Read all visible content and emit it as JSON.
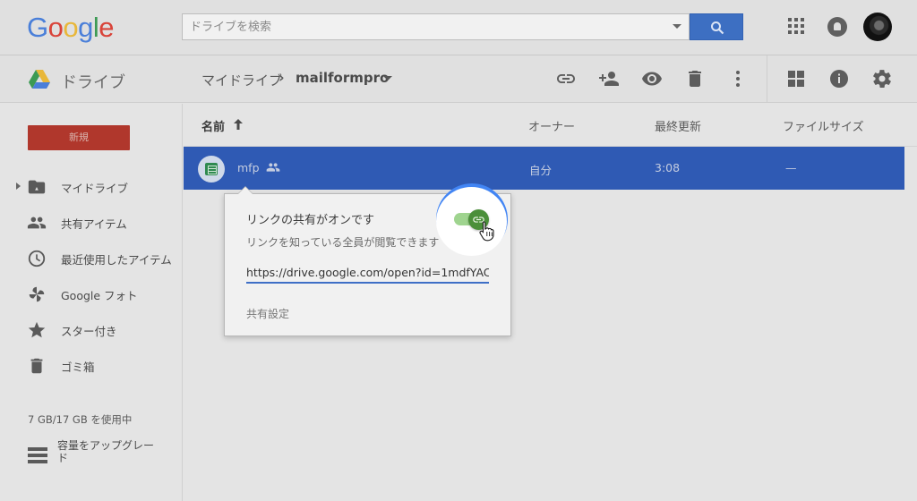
{
  "header": {
    "logo_letters": [
      {
        "ch": "G",
        "color": "#4a7fd9"
      },
      {
        "ch": "o",
        "color": "#d9443a"
      },
      {
        "ch": "o",
        "color": "#e8b73a"
      },
      {
        "ch": "g",
        "color": "#4a7fd9"
      },
      {
        "ch": "l",
        "color": "#3c9a54"
      },
      {
        "ch": "e",
        "color": "#d9443a"
      }
    ],
    "search_placeholder": "ドライブを検索",
    "icons": [
      "apps-icon",
      "notifications-icon",
      "avatar"
    ]
  },
  "subbar": {
    "app_name": "ドライブ",
    "breadcrumb_root": "マイドライブ",
    "breadcrumb_sep": "›",
    "breadcrumb_current": "mailformpro",
    "toolbar_icons": [
      "link-icon",
      "add-person-icon",
      "preview-icon",
      "trash-icon",
      "more-vert-icon",
      "grid-view-icon",
      "info-icon",
      "settings-icon"
    ]
  },
  "sidebar": {
    "new_label": "新規",
    "items": [
      {
        "label": "マイドライブ",
        "icon": "my-drive-icon"
      },
      {
        "label": "共有アイテム",
        "icon": "shared-icon"
      },
      {
        "label": "最近使用したアイテム",
        "icon": "recent-icon"
      },
      {
        "label": "Google フォト",
        "icon": "photos-icon"
      },
      {
        "label": "スター付き",
        "icon": "star-icon"
      },
      {
        "label": "ゴミ箱",
        "icon": "trash-icon"
      }
    ],
    "quota": "7 GB/17 GB を使用中",
    "upgrade": "容量をアップグレード"
  },
  "list": {
    "headers": {
      "name": "名前",
      "owner": "オーナー",
      "modified": "最終更新",
      "size": "ファイルサイズ"
    },
    "rows": [
      {
        "name": "mfp",
        "owner": "自分",
        "modified": "3:08",
        "size": "—",
        "selected": true
      }
    ]
  },
  "share_popup": {
    "title": "リンクの共有がオンです",
    "subtitle": "リンクを知っている全員が閲覧できます",
    "url": "https://drive.google.com/open?id=1mdfYAC",
    "settings_link": "共有設定",
    "toggle_on": true,
    "accent": "#4285f4"
  }
}
